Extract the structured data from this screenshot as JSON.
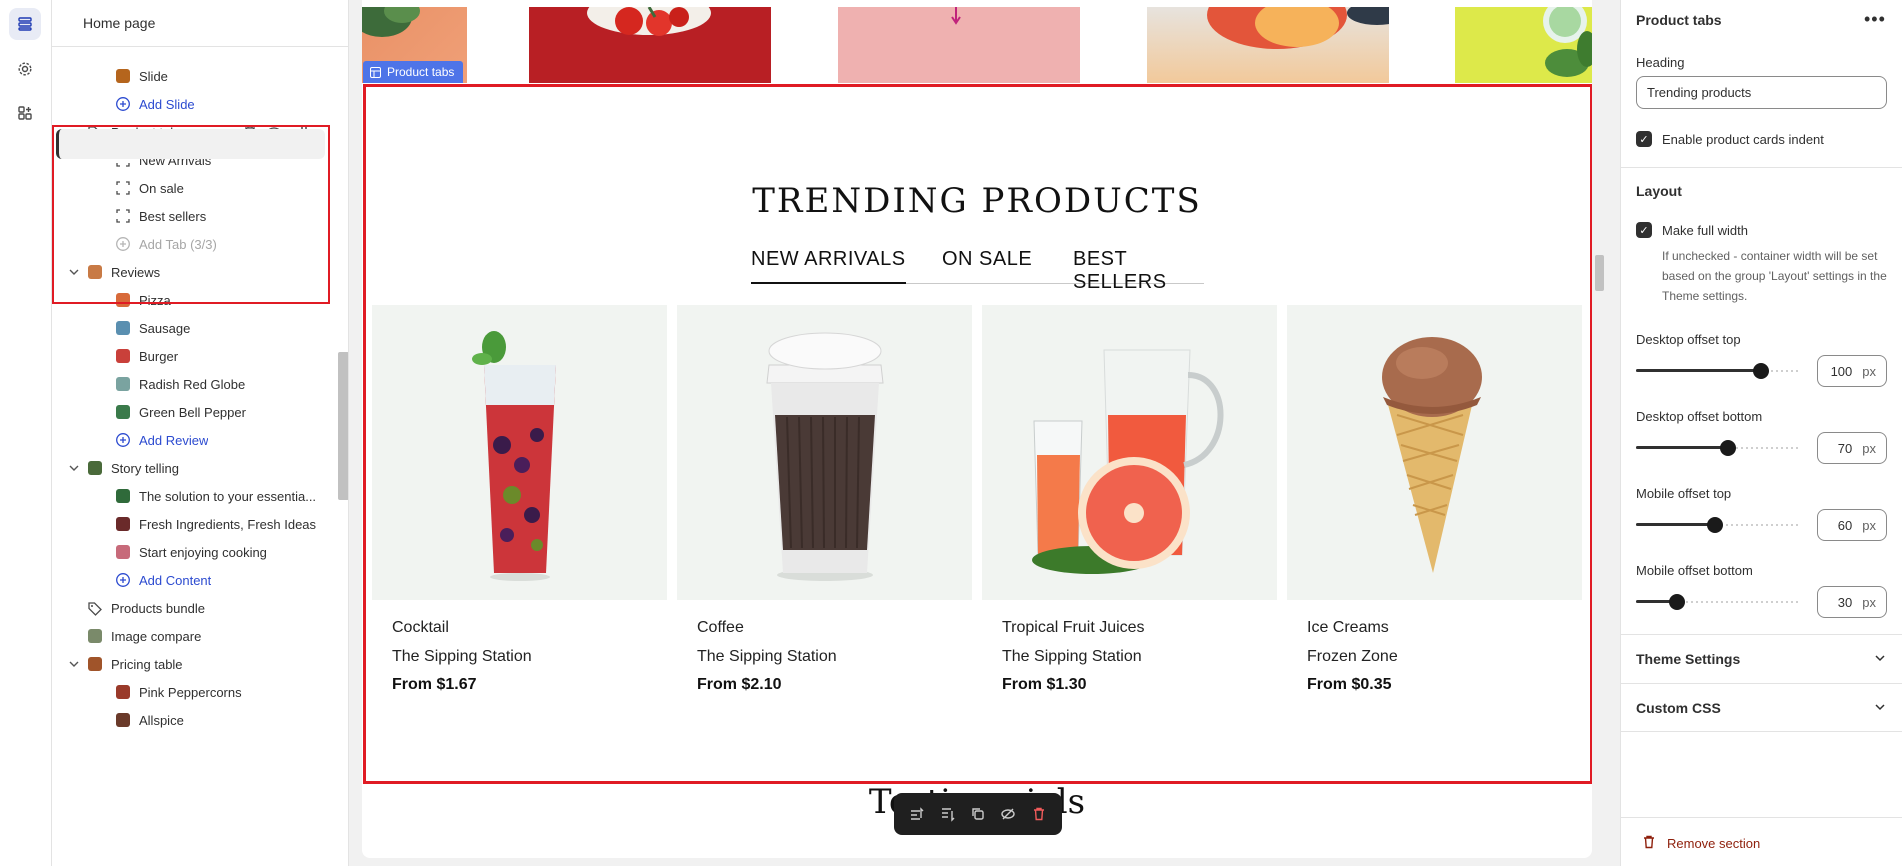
{
  "sidebar": {
    "title": "Home page",
    "rows": [
      {
        "label": "Slide"
      },
      {
        "label": "Add Slide"
      },
      {
        "label": "Product tabs"
      },
      {
        "label": "New Arrivals"
      },
      {
        "label": "On sale"
      },
      {
        "label": "Best sellers"
      },
      {
        "label": "Add Tab (3/3)"
      },
      {
        "label": "Reviews"
      },
      {
        "label": "Pizza"
      },
      {
        "label": "Sausage"
      },
      {
        "label": "Burger"
      },
      {
        "label": "Radish Red Globe"
      },
      {
        "label": "Green Bell Pepper"
      },
      {
        "label": "Add Review"
      },
      {
        "label": "Story telling"
      },
      {
        "label": "The solution to your essentia..."
      },
      {
        "label": "Fresh Ingredients, Fresh Ideas"
      },
      {
        "label": "Start enjoying cooking"
      },
      {
        "label": "Add Content"
      },
      {
        "label": "Products bundle"
      },
      {
        "label": "Image compare"
      },
      {
        "label": "Pricing table"
      },
      {
        "label": "Pink Peppercorns"
      },
      {
        "label": "Allspice"
      }
    ]
  },
  "canvas": {
    "section_tag": "Product tabs",
    "heading": "TRENDING PRODUCTS",
    "tabs": [
      "NEW ARRIVALS",
      "ON SALE",
      "BEST SELLERS"
    ],
    "active_tab": "NEW ARRIVALS",
    "products": [
      {
        "name": "Cocktail",
        "store": "The Sipping Station",
        "price": "From $1.67"
      },
      {
        "name": "Coffee",
        "store": "The Sipping Station",
        "price": "From $2.10"
      },
      {
        "name": "Tropical Fruit Juices",
        "store": "The Sipping Station",
        "price": "From $1.30"
      },
      {
        "name": "Ice Creams",
        "store": "Frozen Zone",
        "price": "From $0.35"
      }
    ],
    "next_section_title": "Testimonials"
  },
  "panel": {
    "title": "Product tabs",
    "more": "•••",
    "heading_label": "Heading",
    "heading_value": "Trending products",
    "enable_indent_label": "Enable product cards indent",
    "enable_indent_checked": true,
    "layout_heading": "Layout",
    "full_width_label": "Make full width",
    "full_width_checked": true,
    "full_width_help": "If unchecked - container width will be set based on the group 'Layout' settings in the Theme settings.",
    "sliders": [
      {
        "label": "Desktop offset top",
        "value": "100",
        "unit": "px",
        "fraction": 0.79
      },
      {
        "label": "Desktop offset bottom",
        "value": "70",
        "unit": "px",
        "fraction": 0.57
      },
      {
        "label": "Mobile offset top",
        "value": "60",
        "unit": "px",
        "fraction": 0.48
      },
      {
        "label": "Mobile offset bottom",
        "value": "30",
        "unit": "px",
        "fraction": 0.22
      }
    ],
    "theme_settings": "Theme Settings",
    "custom_css": "Custom CSS",
    "remove_section": "Remove section"
  },
  "colors": {
    "highlight": "#e01b24",
    "accent": "#2c4bd0",
    "section_tag": "#4e74e8",
    "danger": "#8e1f0b"
  }
}
